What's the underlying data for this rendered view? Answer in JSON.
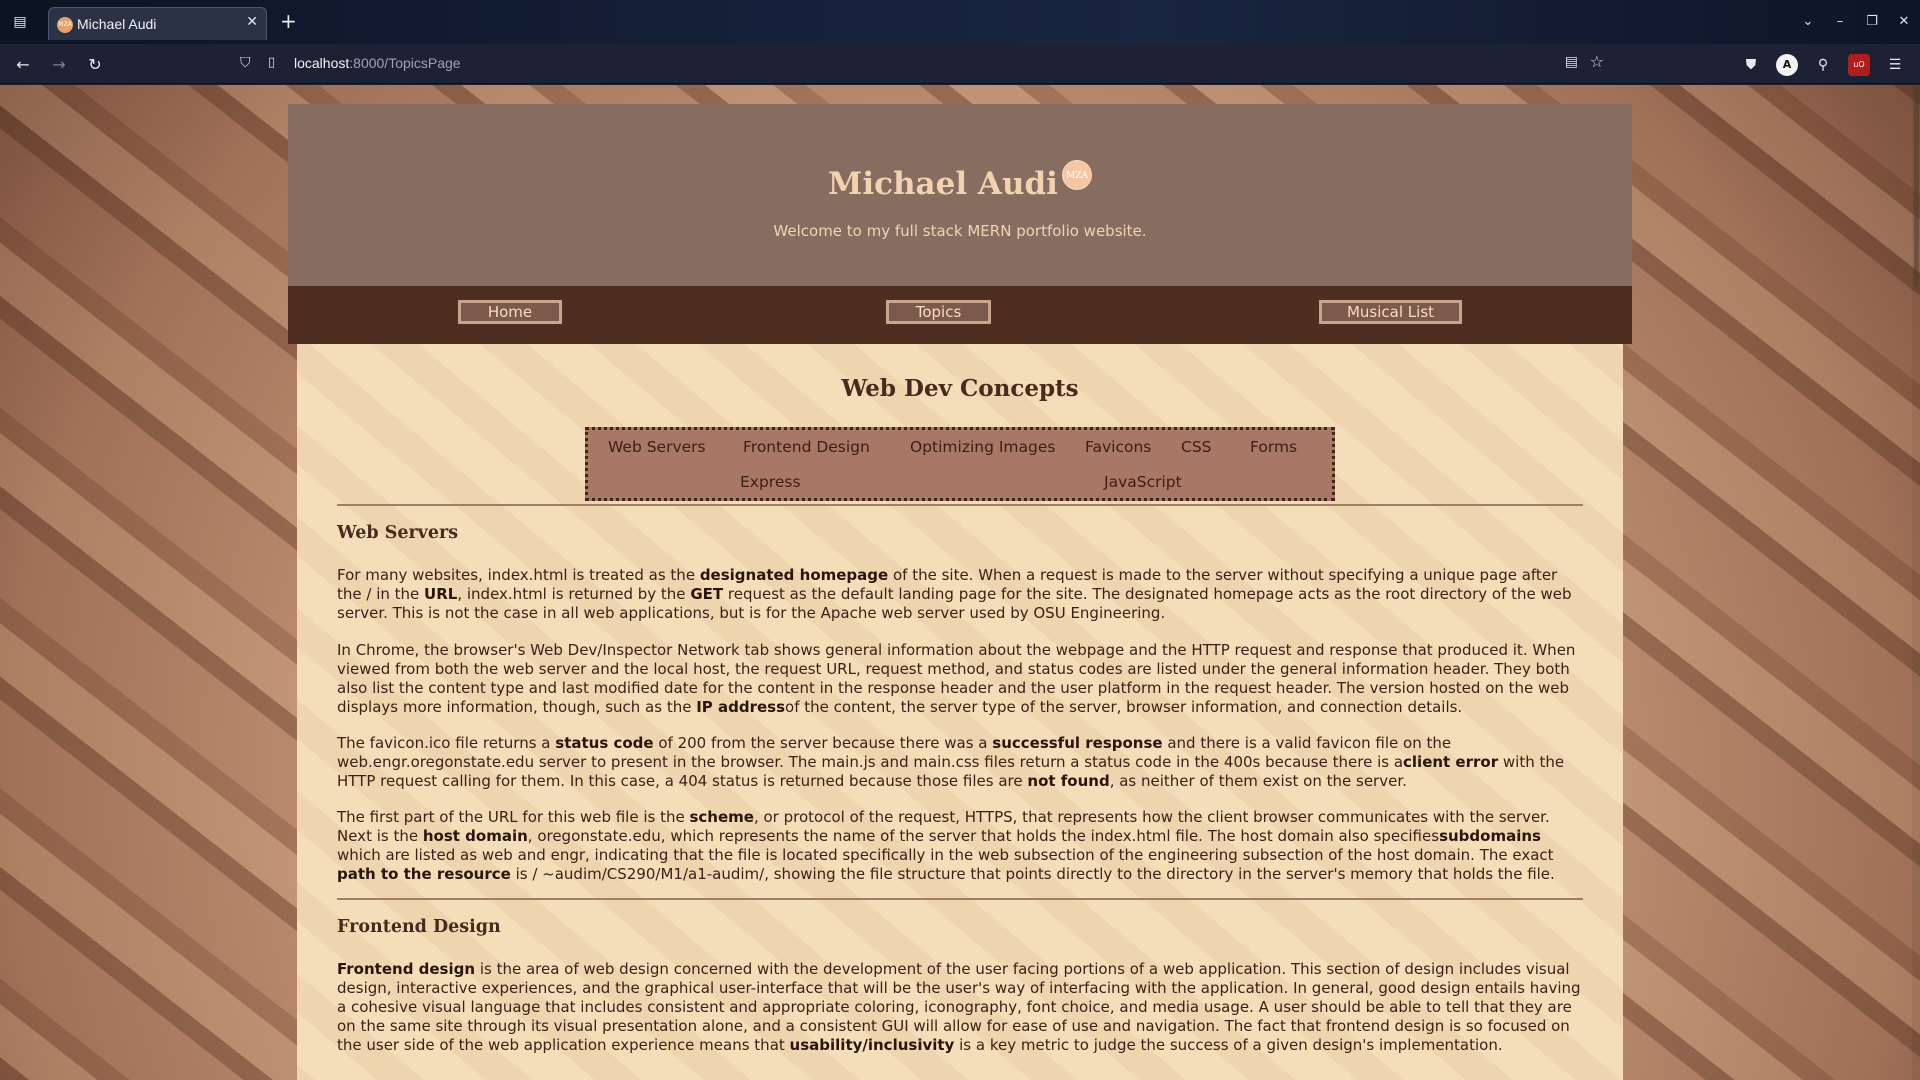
{
  "browser": {
    "tab_title": "Michael Audi",
    "url_host": "localhost",
    "url_path": ":8000/TopicsPage"
  },
  "site": {
    "title": "Michael Audi",
    "logo_text": "MZA",
    "tagline": "Welcome to my full stack MERN portfolio website.",
    "nav": [
      "Home",
      "Topics",
      "Musical List"
    ]
  },
  "page": {
    "heading": "Web Dev Concepts",
    "topics": [
      "Web Servers",
      "Frontend Design",
      "Optimizing Images",
      "Favicons",
      "CSS",
      "Forms",
      "Express",
      "JavaScript"
    ]
  },
  "sections": {
    "web_servers": {
      "title": "Web Servers",
      "p1": [
        {
          "t": "For many websites, index.html is treated as the "
        },
        {
          "b": "designated homepage"
        },
        {
          "t": " of the site. When a request is made to the server without specifying a unique page after the / in the "
        },
        {
          "b": "URL"
        },
        {
          "t": ", index.html is returned by the "
        },
        {
          "b": "GET"
        },
        {
          "t": " request as the default landing page for the site. The designated homepage acts as the root directory of the web server. This is not the case in all web applications, but is for the Apache web server used by OSU Engineering."
        }
      ],
      "p2": [
        {
          "t": "In Chrome, the browser's Web Dev/Inspector Network tab shows general information about the webpage and the HTTP request and response that produced it. When viewed from both the web server and the local host, the request URL, request method, and status codes are listed under the general information header. They both also list the content type and last modified date for the content in the response header and the user platform in the request header. The version hosted on the web displays more information, though, such as the "
        },
        {
          "b": "IP address"
        },
        {
          "t": "of the content, the server type of the server, browser information, and connection details."
        }
      ],
      "p3": [
        {
          "t": "The favicon.ico file returns a "
        },
        {
          "b": "status code"
        },
        {
          "t": " of 200 from the server because there was a "
        },
        {
          "b": "successful response"
        },
        {
          "t": " and there is a valid favicon file on the web.engr.oregonstate.edu server to present in the browser. The main.js and main.css files return a status code in the 400s because there is a"
        },
        {
          "b": "client error"
        },
        {
          "t": " with the HTTP request calling for them. In this case, a 404 status is returned because those files are "
        },
        {
          "b": "not found"
        },
        {
          "t": ", as neither of them exist on the server."
        }
      ],
      "p4": [
        {
          "t": "The first part of the URL for this web file is the "
        },
        {
          "b": "scheme"
        },
        {
          "t": ", or protocol of the request, HTTPS, that represents how the client browser communicates with the server. Next is the "
        },
        {
          "b": "host domain"
        },
        {
          "t": ", oregonstate.edu, which represents the name of the server that holds the index.html file. The host domain also specifies"
        },
        {
          "b": "subdomains"
        },
        {
          "t": " which are listed as web and engr, indicating that the file is located specifically in the web subsection of the engineering subsection of the host domain. The exact "
        },
        {
          "b": "path to the resource"
        },
        {
          "t": " is / ~audim/CS290/M1/a1-audim/, showing the file structure that points directly to the directory in the server's memory that holds the file."
        }
      ]
    },
    "frontend_design": {
      "title": "Frontend Design",
      "p1": [
        {
          "b": "Frontend design"
        },
        {
          "t": " is the area of web design concerned with the development of the user facing portions of a web application. This section of design includes visual design, interactive experiences, and the graphical user-interface that will be the user's way of interfacing with the application. In general, good design entails having a cohesive visual language that includes consistent and appropriate coloring, iconography, font choice, and media usage. A user should be able to tell that they are on the same site through its visual presentation alone, and a consistent GUI will allow for ease of use and navigation. The fact that frontend design is so focused on the user side of the web application experience means that "
        },
        {
          "b": "usability/inclusivity"
        },
        {
          "t": " is a key metric to judge the success of a given design's implementation."
        }
      ]
    }
  }
}
